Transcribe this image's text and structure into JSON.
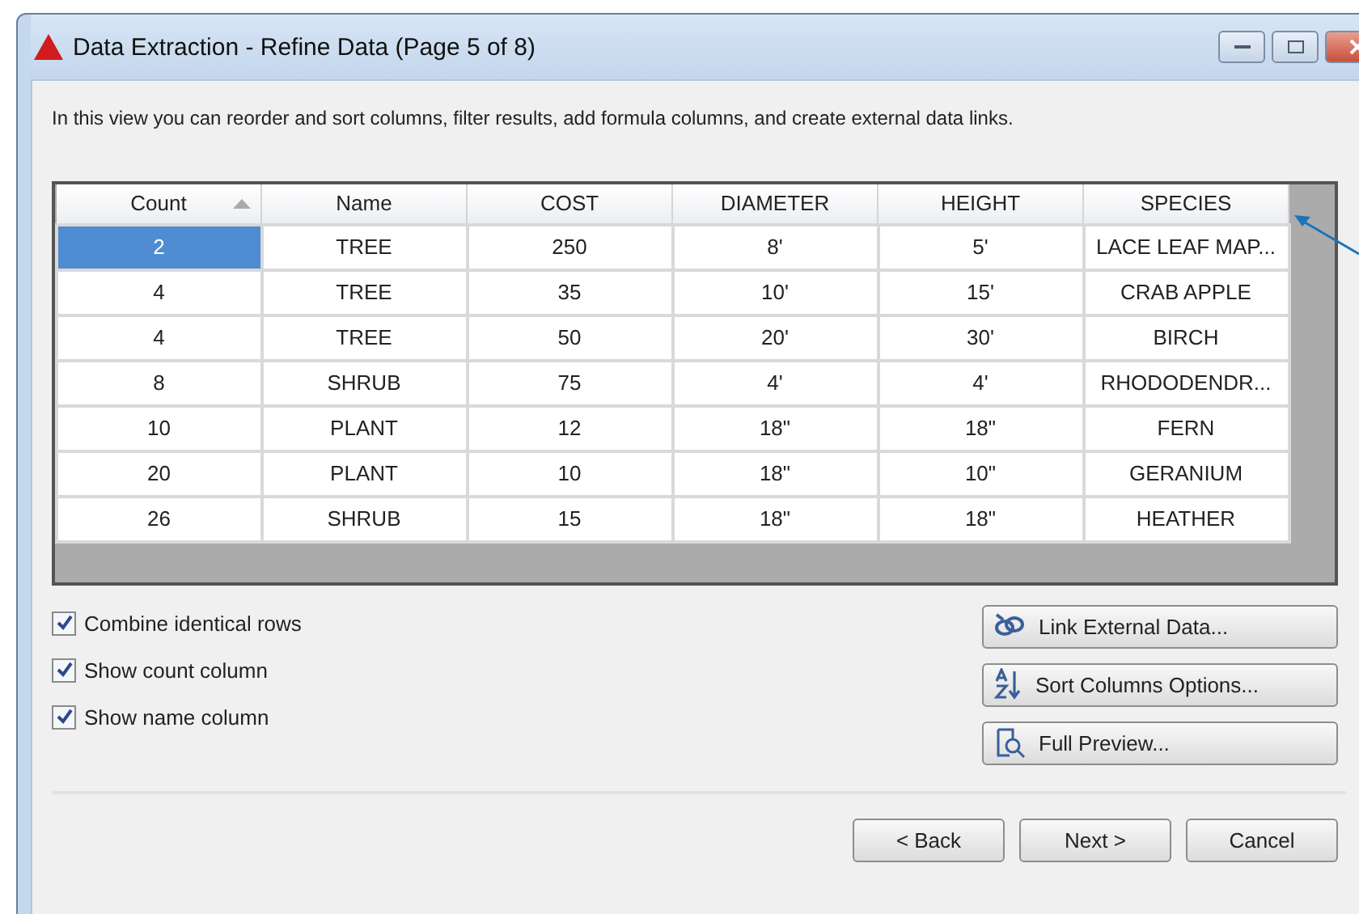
{
  "window": {
    "title": "Data Extraction - Refine Data (Page 5 of 8)"
  },
  "description": "In this view you can reorder and sort columns, filter results, add formula columns, and create external data links.",
  "table": {
    "columns": [
      {
        "label": "Count",
        "sorted": true
      },
      {
        "label": "Name",
        "sorted": false
      },
      {
        "label": "COST",
        "sorted": false
      },
      {
        "label": "DIAMETER",
        "sorted": false
      },
      {
        "label": "HEIGHT",
        "sorted": false
      },
      {
        "label": "SPECIES",
        "sorted": false
      }
    ],
    "rows": [
      {
        "selected": true,
        "cells": [
          "2",
          "TREE",
          "250",
          "8'",
          "5'",
          "LACE LEAF MAP..."
        ]
      },
      {
        "selected": false,
        "cells": [
          "4",
          "TREE",
          "35",
          "10'",
          "15'",
          "CRAB APPLE"
        ]
      },
      {
        "selected": false,
        "cells": [
          "4",
          "TREE",
          "50",
          "20'",
          "30'",
          "BIRCH"
        ]
      },
      {
        "selected": false,
        "cells": [
          "8",
          "SHRUB",
          "75",
          "4'",
          "4'",
          "RHODODENDR..."
        ]
      },
      {
        "selected": false,
        "cells": [
          "10",
          "PLANT",
          "12",
          "18\"",
          "18\"",
          "FERN"
        ]
      },
      {
        "selected": false,
        "cells": [
          "20",
          "PLANT",
          "10",
          "18\"",
          "10\"",
          "GERANIUM"
        ]
      },
      {
        "selected": false,
        "cells": [
          "26",
          "SHRUB",
          "15",
          "18\"",
          "18\"",
          "HEATHER"
        ]
      }
    ]
  },
  "options": [
    {
      "label": "Combine identical rows",
      "checked": true
    },
    {
      "label": "Show count column",
      "checked": true
    },
    {
      "label": "Show name column",
      "checked": true
    }
  ],
  "actions": [
    {
      "label": "Link External Data...",
      "kind": "link"
    },
    {
      "label": "Sort Columns Options...",
      "kind": "sort"
    },
    {
      "label": "Full Preview...",
      "kind": "preview"
    }
  ],
  "buttons": [
    "< Back",
    "Next >",
    "Cancel"
  ]
}
